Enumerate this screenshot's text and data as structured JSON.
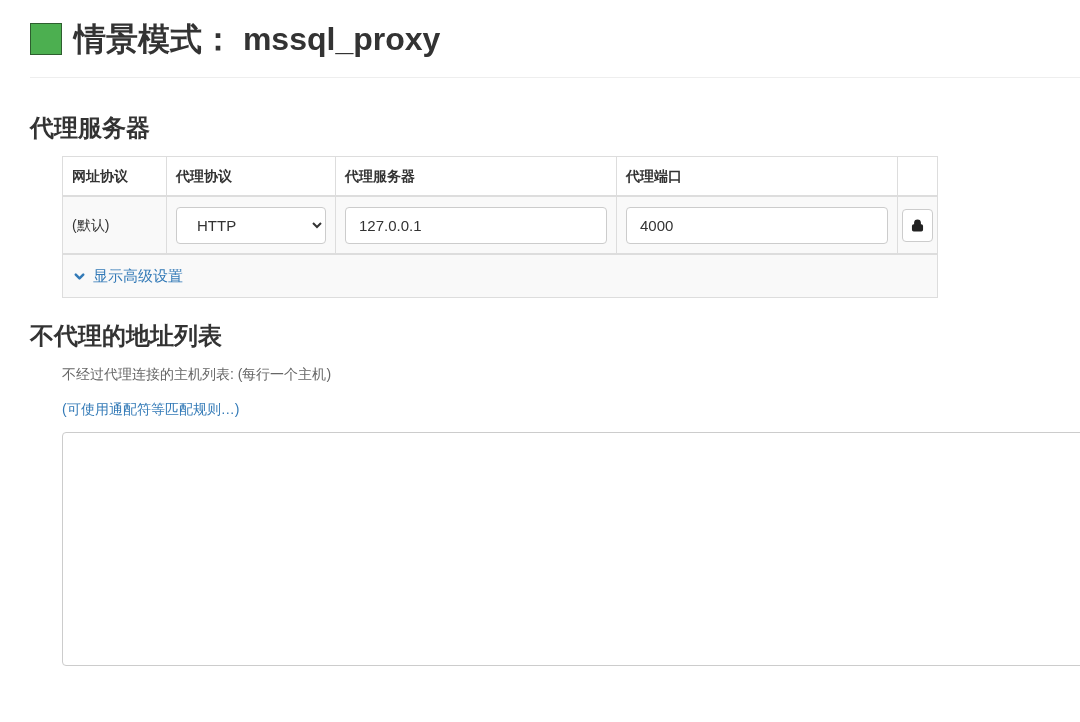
{
  "profile": {
    "label": "情景模式：",
    "name": "mssql_proxy"
  },
  "proxy_section": {
    "title": "代理服务器",
    "table": {
      "columns": [
        "网址协议",
        "代理协议",
        "代理服务器",
        "代理端口"
      ],
      "rows": [
        {
          "scheme": "(默认)",
          "protocol": "HTTP",
          "server": "127.0.0.1",
          "port": "4000"
        }
      ],
      "advanced_link": "显示高级设置"
    }
  },
  "bypass_section": {
    "title": "不代理的地址列表",
    "hint": "不经过代理连接的主机列表: (每行一个主机)",
    "link": "(可使用通配符等匹配规则…)"
  }
}
